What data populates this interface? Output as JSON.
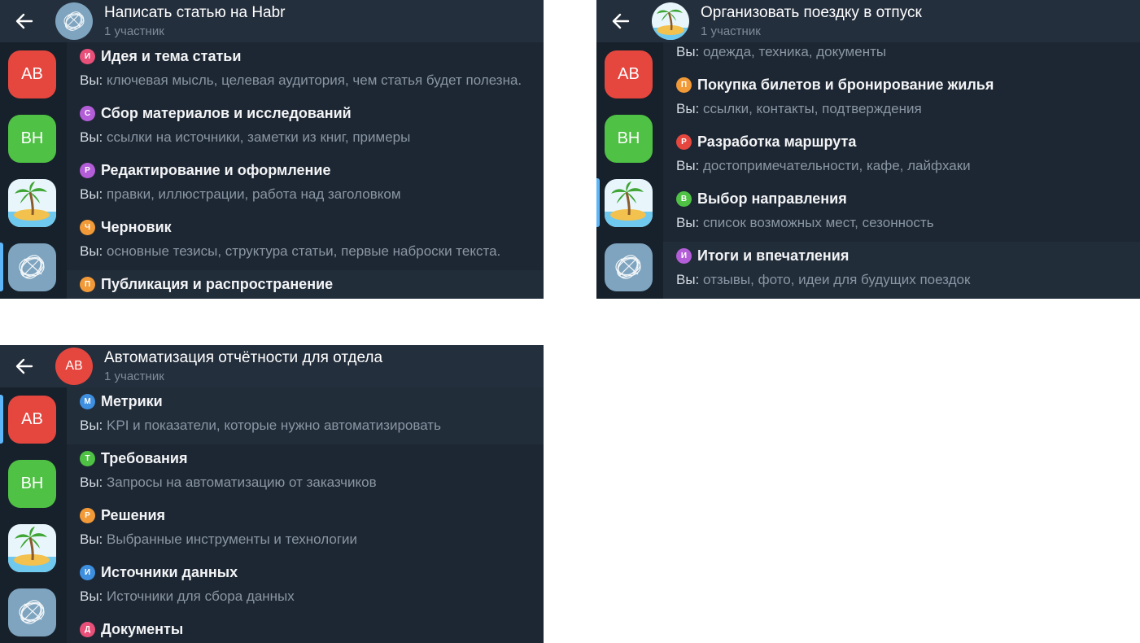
{
  "common": {
    "you_label": "Вы:"
  },
  "panels": [
    {
      "title": "Написать статью на Habr",
      "subtitle": "1 участник",
      "rows": [
        {
          "badge": "И",
          "badge_color": "#e8507a",
          "title": "Идея и тема статьи",
          "sub": "ключевая мысль, целевая аудитория, чем статья будет полезна."
        },
        {
          "badge": "С",
          "badge_color": "#b35ed8",
          "title": "Сбор материалов и исследований",
          "sub": "ссылки на источники, заметки из книг, примеры"
        },
        {
          "badge": "Р",
          "badge_color": "#b35ed8",
          "title": "Редактирование и оформление",
          "sub": "правки, иллюстрации, работа над заголовком"
        },
        {
          "badge": "Ч",
          "badge_color": "#f29a38",
          "title": "Черновик",
          "sub": "основные тезисы, структура статьи, первые наброски текста."
        },
        {
          "badge": "П",
          "badge_color": "#f29a38",
          "title": "Публикация и распространение",
          "sub": ""
        }
      ]
    },
    {
      "title": "Организовать поездку в отпуск",
      "subtitle": "1 участник",
      "rows": [
        {
          "badge": "",
          "badge_color": "",
          "title": "",
          "sub": "одежда, техника, документы"
        },
        {
          "badge": "П",
          "badge_color": "#f29a38",
          "title": "Покупка билетов и бронирование жилья",
          "sub": "ссылки, контакты, подтверждения"
        },
        {
          "badge": "Р",
          "badge_color": "#e5473f",
          "title": "Разработка маршрута",
          "sub": "достопримечательности, кафе, лайфхаки"
        },
        {
          "badge": "В",
          "badge_color": "#4fc145",
          "title": "Выбор направления",
          "sub": "список возможных мест, сезонность"
        },
        {
          "badge": "И",
          "badge_color": "#b35ed8",
          "title": "Итоги и впечатления",
          "sub": "отзывы, фото, идеи для будущих поездок"
        }
      ]
    },
    {
      "title": "Автоматизация отчётности для отдела",
      "subtitle": "1 участник",
      "rows": [
        {
          "badge": "М",
          "badge_color": "#3f8fe0",
          "title": "Метрики",
          "sub": "KPI и показатели, которые нужно автоматизировать"
        },
        {
          "badge": "Т",
          "badge_color": "#4fc145",
          "title": "Требования",
          "sub": "Запросы на автоматизацию от заказчиков"
        },
        {
          "badge": "Р",
          "badge_color": "#f29a38",
          "title": "Решения",
          "sub": "Выбранные инструменты и технологии"
        },
        {
          "badge": "И",
          "badge_color": "#3f8fe0",
          "title": "Источники данных",
          "sub": "Источники для сбора данных"
        },
        {
          "badge": "Д",
          "badge_color": "#e8507a",
          "title": "Документы",
          "sub": ""
        }
      ]
    }
  ],
  "sidebar": {
    "items": [
      {
        "initials": "АВ",
        "color": "#e5473f"
      },
      {
        "initials": "ВН",
        "color": "#4fc145"
      },
      {
        "initials": "",
        "color": "#6fc9ef"
      },
      {
        "initials": "",
        "color": "#7ea4bf"
      }
    ]
  },
  "header3_avatar_initials": "АВ"
}
